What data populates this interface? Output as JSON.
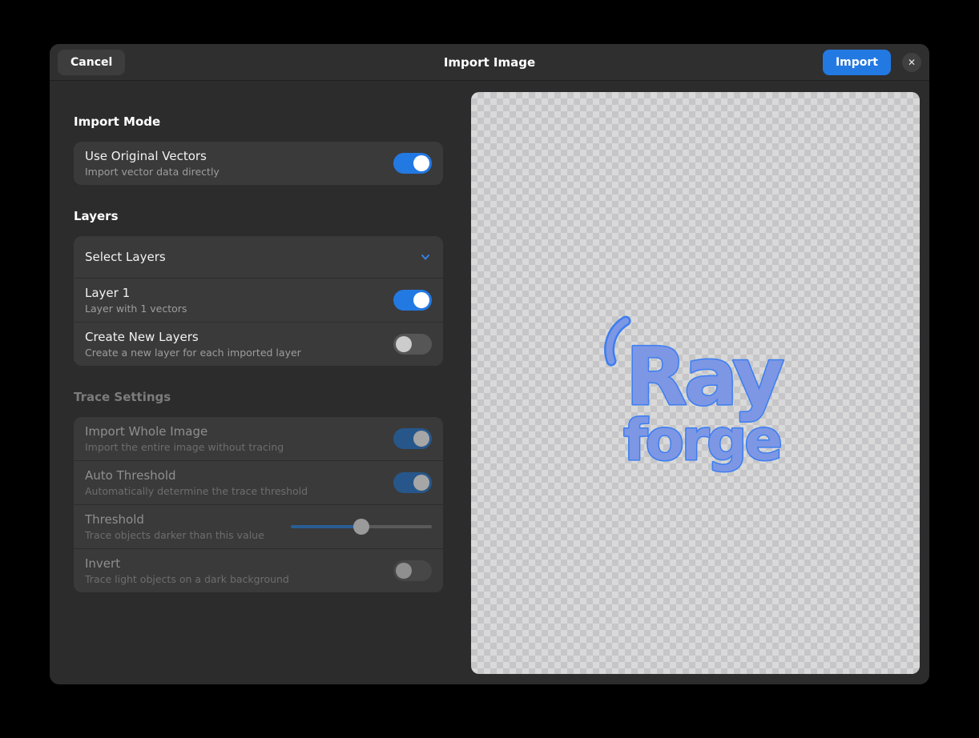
{
  "header": {
    "cancel_label": "Cancel",
    "title": "Import Image",
    "import_label": "Import",
    "close_icon": "✕"
  },
  "panel": {
    "sections": [
      {
        "header": "Import Mode",
        "rows": [
          {
            "title": "Use Original Vectors",
            "subtitle": "Import vector data directly",
            "control": "toggle",
            "state": "on",
            "disabled": false
          }
        ]
      },
      {
        "header": "Layers",
        "rows": [
          {
            "title": "Select Layers",
            "control": "expander",
            "state": "collapsed",
            "disabled": false
          },
          {
            "title": "Layer 1",
            "subtitle": "Layer with 1 vectors",
            "control": "toggle",
            "state": "on",
            "disabled": false
          },
          {
            "title": "Create New Layers",
            "subtitle": "Create a new layer for each imported layer",
            "control": "toggle",
            "state": "off",
            "disabled": false
          }
        ]
      },
      {
        "header": "Trace Settings",
        "disabled": true,
        "rows": [
          {
            "title": "Import Whole Image",
            "subtitle": "Import the entire image without tracing",
            "control": "toggle",
            "state": "on",
            "disabled": true
          },
          {
            "title": "Auto Threshold",
            "subtitle": "Automatically determine the trace threshold",
            "control": "toggle",
            "state": "on",
            "disabled": true
          },
          {
            "title": "Threshold",
            "subtitle": "Trace objects darker than this value",
            "control": "slider",
            "value_percent": 50,
            "disabled": true
          },
          {
            "title": "Invert",
            "subtitle": "Trace light objects on a dark background",
            "control": "toggle",
            "state": "off",
            "disabled": true
          }
        ]
      }
    ]
  },
  "preview": {
    "logo_line1": "Ray",
    "logo_line2": "forge"
  },
  "colors": {
    "accent": "#2379e2",
    "dim_accent": "#27578a",
    "window_bg": "#2c2c2c",
    "row_bg": "#3a3a3a",
    "logo_fill": "#7d97e4",
    "logo_outline": "#3c7ef0",
    "checker_light": "#d9d9d9",
    "checker_dark": "#c6c6c9"
  }
}
